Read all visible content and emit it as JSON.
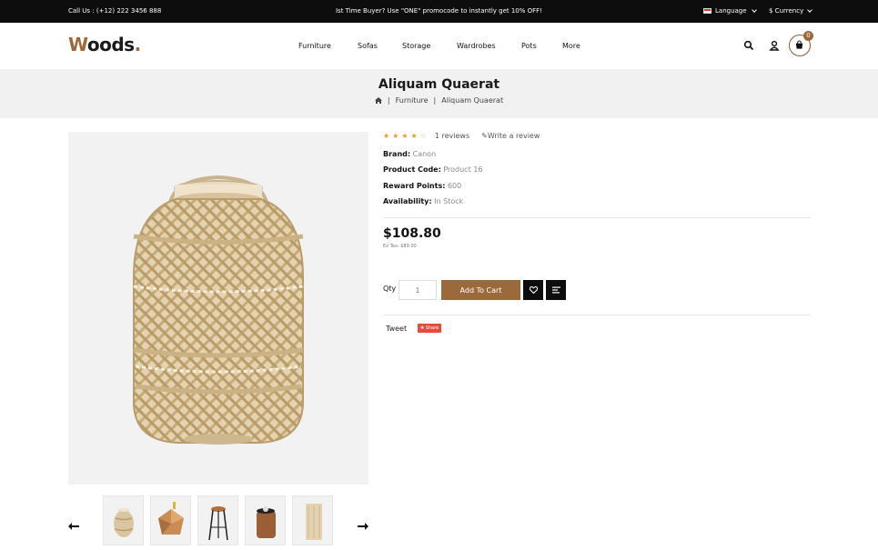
{
  "topbar": {
    "call": "Call Us : (+12) 222 3456 888",
    "promo": "Ist Time Buyer? Use \"ONE\" promocode to instantly get 10% OFF!",
    "language": "Language",
    "currency": "$ Currency"
  },
  "header": {
    "logo_first": "W",
    "logo_rest": "oods",
    "logo_dot": ".",
    "nav": [
      "Furniture",
      "Sofas",
      "Storage",
      "Wardrobes",
      "Pots",
      "More"
    ],
    "cart_count": "0"
  },
  "page": {
    "title": "Aliquam Quaerat",
    "breadcrumb": [
      "Furniture",
      "Aliquam Quaerat"
    ],
    "breadcrumb_sep": "|"
  },
  "product": {
    "rating": 4,
    "rating_max": 5,
    "reviews": "1 reviews",
    "write_review": "Write a review",
    "brand_label": "Brand:",
    "brand": "Canon",
    "code_label": "Product Code:",
    "code": "Product 16",
    "points_label": "Reward Points:",
    "points": "600",
    "availability_label": "Availability:",
    "availability": "In Stock",
    "price": "$108.80",
    "ex_tax": "Ex Tax: $89.00",
    "qty_label": "Qty",
    "qty_value": "1",
    "add_to_cart": "Add To Cart",
    "tweet": "Tweet",
    "share": "Share"
  },
  "colors": {
    "accent": "#9b6a3a",
    "topbar": "#0d0d0d",
    "band": "#f1f1f1",
    "star": "#e69b2a",
    "share": "#e84b3c"
  },
  "icons": {
    "search": "search-icon",
    "account": "user-icon",
    "cart": "cart-icon",
    "home": "home-icon",
    "wishlist": "heart-icon",
    "compare": "compare-icon",
    "prev": "arrow-left-icon",
    "next": "arrow-right-icon"
  }
}
